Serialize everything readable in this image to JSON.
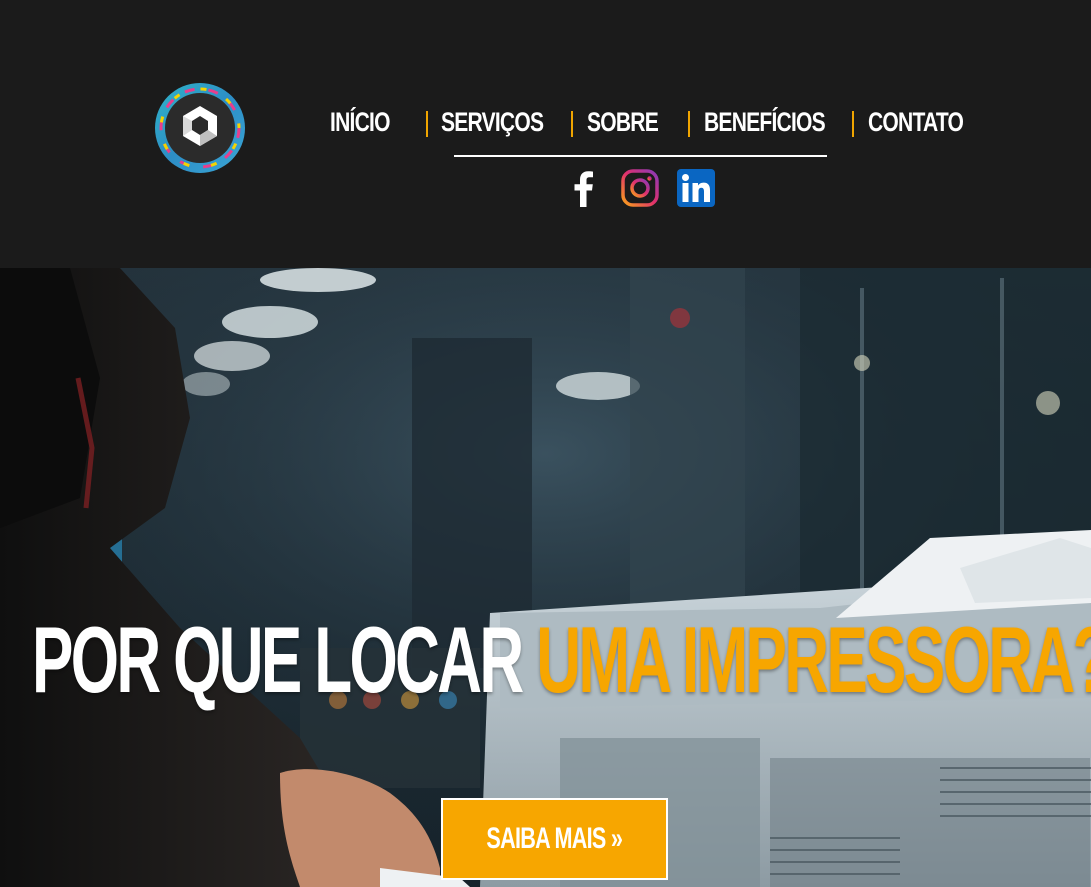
{
  "brand": {
    "logo_icon": "cube-logo-icon",
    "colors": {
      "accent": "#f7a600",
      "header_bg": "#1b1b1b",
      "text": "#ffffff"
    }
  },
  "nav": {
    "items": [
      {
        "label": "INÍCIO"
      },
      {
        "label": "SERVIÇOS"
      },
      {
        "label": "SOBRE"
      },
      {
        "label": "BENEFÍCIOS"
      },
      {
        "label": "CONTATO"
      }
    ]
  },
  "social": [
    {
      "icon": "facebook-icon"
    },
    {
      "icon": "instagram-icon"
    },
    {
      "icon": "linkedin-icon"
    }
  ],
  "hero": {
    "title_white": "POR QUE LOCAR",
    "title_orange": "UMA IMPRESSORA?",
    "cta_label": "SAIBA MAIS »"
  }
}
